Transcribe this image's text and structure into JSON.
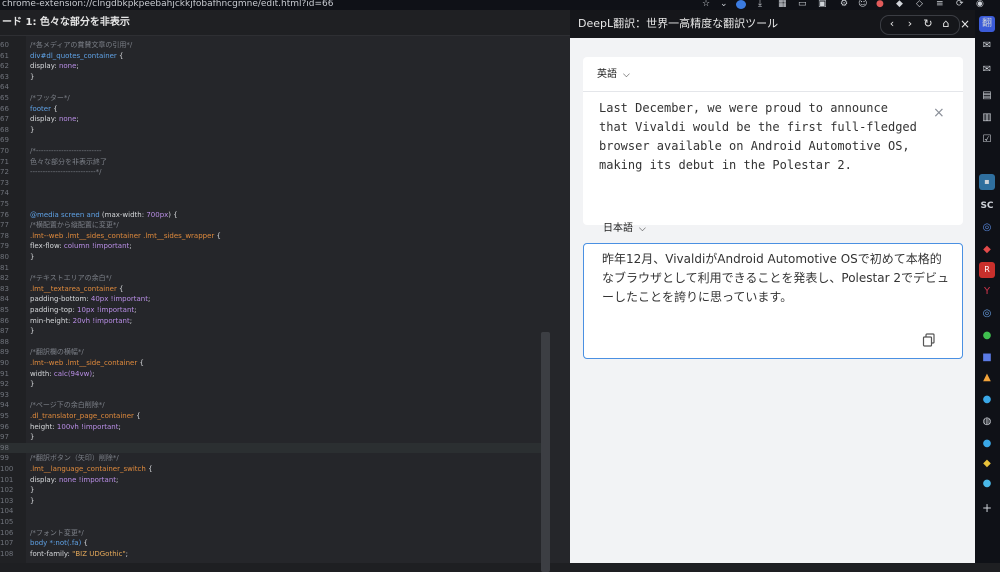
{
  "topbar": {
    "url": "chrome-extension://clngdbkpkpeebahjckkjfobafhncgmne/edit.html?id=66"
  },
  "editor": {
    "title": "ード 1: 色々な部分を非表示",
    "lines": [
      {
        "n": "60",
        "tokens": [
          [
            "c-com",
            "/*各メディアの賞賛文章の引用*/"
          ]
        ]
      },
      {
        "n": "61",
        "tokens": [
          [
            "c-sel",
            "div#dl_quotes_container"
          ],
          [
            "c-pun",
            " {"
          ]
        ]
      },
      {
        "n": "62",
        "tokens": [
          [
            "c-prop",
            "  display: "
          ],
          [
            "c-val",
            "none"
          ],
          [
            "c-pun",
            ";"
          ]
        ]
      },
      {
        "n": "63",
        "tokens": [
          [
            "c-pun",
            "}"
          ]
        ]
      },
      {
        "n": "64",
        "tokens": []
      },
      {
        "n": "65",
        "tokens": [
          [
            "c-com",
            "/*フッター*/"
          ]
        ]
      },
      {
        "n": "66",
        "tokens": [
          [
            "c-sel",
            "footer"
          ],
          [
            "c-pun",
            " {"
          ]
        ]
      },
      {
        "n": "67",
        "tokens": [
          [
            "c-prop",
            "  display: "
          ],
          [
            "c-val",
            "none"
          ],
          [
            "c-pun",
            ";"
          ]
        ]
      },
      {
        "n": "68",
        "tokens": [
          [
            "c-pun",
            "}"
          ]
        ]
      },
      {
        "n": "69",
        "tokens": []
      },
      {
        "n": "70",
        "tokens": [
          [
            "c-com",
            "/*--------------------------"
          ]
        ]
      },
      {
        "n": "71",
        "tokens": [
          [
            "c-com",
            "色々な部分を非表示終了"
          ]
        ]
      },
      {
        "n": "72",
        "tokens": [
          [
            "c-com",
            "--------------------------*/"
          ]
        ]
      },
      {
        "n": "73",
        "tokens": []
      },
      {
        "n": "74",
        "tokens": []
      },
      {
        "n": "75",
        "tokens": []
      },
      {
        "n": "76",
        "tokens": [
          [
            "c-sel",
            "@media screen and"
          ],
          [
            "c-pun",
            " (max-width: "
          ],
          [
            "c-val",
            "700px"
          ],
          [
            "c-pun",
            ") {"
          ]
        ]
      },
      {
        "n": "77",
        "tokens": [
          [
            "c-com",
            "/*横配置から縦配置に変更*/"
          ]
        ]
      },
      {
        "n": "78",
        "tokens": [
          [
            "c-cls",
            ".lmt--web .lmt__sides_container .lmt__sides_wrapper"
          ],
          [
            "c-pun",
            " {"
          ]
        ]
      },
      {
        "n": "79",
        "tokens": [
          [
            "c-prop",
            "  flex-flow: "
          ],
          [
            "c-val",
            "column !important"
          ],
          [
            "c-pun",
            ";"
          ]
        ]
      },
      {
        "n": "80",
        "tokens": [
          [
            "c-pun",
            "}"
          ]
        ]
      },
      {
        "n": "81",
        "tokens": []
      },
      {
        "n": "82",
        "tokens": [
          [
            "c-com",
            "/*テキストエリアの余白*/"
          ]
        ]
      },
      {
        "n": "83",
        "tokens": [
          [
            "c-cls",
            ".lmt__textarea_container"
          ],
          [
            "c-pun",
            " {"
          ]
        ]
      },
      {
        "n": "84",
        "tokens": [
          [
            "c-prop",
            "  padding-bottom: "
          ],
          [
            "c-val",
            "40px !important"
          ],
          [
            "c-pun",
            ";"
          ]
        ]
      },
      {
        "n": "85",
        "tokens": [
          [
            "c-prop",
            "  padding-top: "
          ],
          [
            "c-val",
            "10px !important"
          ],
          [
            "c-pun",
            ";"
          ]
        ]
      },
      {
        "n": "86",
        "tokens": [
          [
            "c-prop",
            "  min-height: "
          ],
          [
            "c-val",
            "20vh !important"
          ],
          [
            "c-pun",
            ";"
          ]
        ]
      },
      {
        "n": "87",
        "tokens": [
          [
            "c-pun",
            "}"
          ]
        ]
      },
      {
        "n": "88",
        "tokens": []
      },
      {
        "n": "89",
        "tokens": [
          [
            "c-com",
            "/*翻訳欄の横幅*/"
          ]
        ]
      },
      {
        "n": "90",
        "tokens": [
          [
            "c-cls",
            ".lmt--web .lmt__side_container"
          ],
          [
            "c-pun",
            " {"
          ]
        ]
      },
      {
        "n": "91",
        "tokens": [
          [
            "c-prop",
            "  width: "
          ],
          [
            "c-val",
            "calc(94vw)"
          ],
          [
            "c-pun",
            ";"
          ]
        ]
      },
      {
        "n": "92",
        "tokens": [
          [
            "c-pun",
            "}"
          ]
        ]
      },
      {
        "n": "93",
        "tokens": []
      },
      {
        "n": "94",
        "tokens": [
          [
            "c-com",
            "/*ページ下の余白削除*/"
          ]
        ]
      },
      {
        "n": "95",
        "tokens": [
          [
            "c-cls",
            ".dl_translator_page_container"
          ],
          [
            "c-pun",
            " {"
          ]
        ]
      },
      {
        "n": "96",
        "tokens": [
          [
            "c-prop",
            "  height: "
          ],
          [
            "c-val",
            "100vh !important"
          ],
          [
            "c-pun",
            ";"
          ]
        ]
      },
      {
        "n": "97",
        "tokens": [
          [
            "c-pun",
            "}"
          ]
        ]
      },
      {
        "n": "98",
        "tokens": []
      },
      {
        "n": "99",
        "tokens": [
          [
            "c-com",
            "/*翻訳ボタン（矢印）削除*/"
          ]
        ]
      },
      {
        "n": "100",
        "tokens": [
          [
            "c-cls",
            ".lmt__language_container_switch"
          ],
          [
            "c-pun",
            " {"
          ]
        ]
      },
      {
        "n": "101",
        "tokens": [
          [
            "c-prop",
            "  display: "
          ],
          [
            "c-val",
            "none !important"
          ],
          [
            "c-pun",
            ";"
          ]
        ]
      },
      {
        "n": "102",
        "tokens": [
          [
            "c-pun",
            "}"
          ]
        ]
      },
      {
        "n": "103",
        "tokens": [
          [
            "c-pun",
            "}"
          ]
        ]
      },
      {
        "n": "104",
        "tokens": []
      },
      {
        "n": "105",
        "tokens": []
      },
      {
        "n": "106",
        "tokens": [
          [
            "c-com",
            "/*フォント変更*/"
          ]
        ]
      },
      {
        "n": "107",
        "tokens": [
          [
            "c-sel",
            "  body *:not(.fa)"
          ],
          [
            "c-pun",
            " {"
          ]
        ]
      },
      {
        "n": "108",
        "tokens": [
          [
            "c-prop",
            "    font-family: "
          ],
          [
            "c-str",
            "\"BIZ UDGothic\""
          ],
          [
            "c-pun",
            ";"
          ]
        ]
      }
    ],
    "active_line": "98"
  },
  "deepl": {
    "title": "DeepL翻訳：世界一高精度な翻訳ツール",
    "source_lang": "英語",
    "source_text": "Last December, we were proud to announce that Vivaldi would be the first full-fledged browser available on Android Automotive OS, making its debut in the Polestar 2.",
    "target_lang": "日本語",
    "target_text": "昨年12月、VivaldiがAndroid Automotive OSで初めて本格的なブラウザとして利用できることを発表し、Polestar 2でデビューしたことを誇りに思っています。",
    "accent": "#4a90e2"
  },
  "icons": {
    "nav_back": "‹",
    "nav_forward": "›",
    "reload": "↻",
    "home": "⌂",
    "close": "×",
    "clear": "×",
    "chevron": "⌵"
  }
}
